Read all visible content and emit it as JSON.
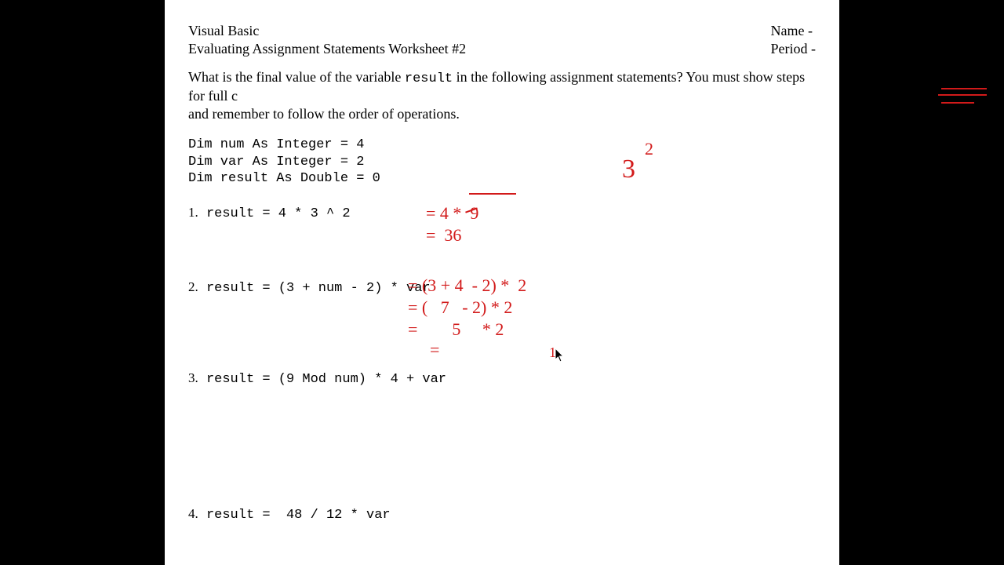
{
  "header": {
    "course": "Visual Basic",
    "title": "Evaluating Assignment Statements Worksheet #2",
    "name_label": "Name -",
    "period_label": "Period -"
  },
  "question": {
    "pre": "What is the final value of the variable ",
    "var": "result",
    "post": " in the following assignment statements? You must show steps for full c",
    "line2": "and remember to follow the order of operations."
  },
  "code": {
    "l1": "Dim num As Integer = 4",
    "l2": "Dim var As Integer = 2",
    "l3": "Dim result As Double = 0"
  },
  "problems": {
    "p1_num": "1.",
    "p1": "result = 4 * 3 ^ 2",
    "p2_num": "2.",
    "p2": "result = (3 + num - 2) * var",
    "p3_num": "3.",
    "p3": "result = (9 Mod num) * 4 + var",
    "p4_num": "4.",
    "p4": "result =  48 / 12 * var"
  },
  "annotations": {
    "exp_base": "3",
    "exp_pow": "2",
    "p1_s1": "= 4 *  9",
    "p1_s2": "=  36",
    "p2_s1": "= (3 + 4  - 2) *  2",
    "p2_s2": "= (   7   - 2) * 2",
    "p2_s3": "=        5     * 2",
    "p2_s4": "=",
    "p3_partial": "1"
  }
}
